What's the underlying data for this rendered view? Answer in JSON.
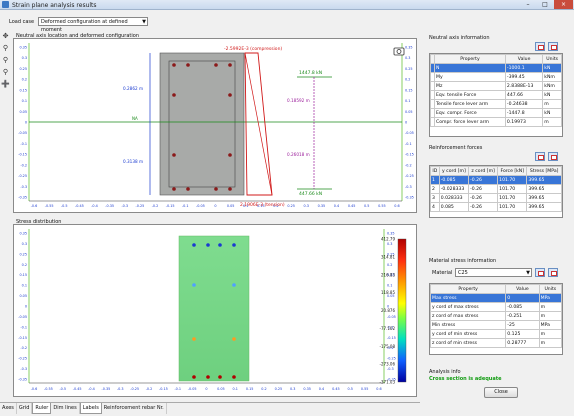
{
  "window": {
    "title": "Strain plane analysis results"
  },
  "toolbar": {
    "load_case_label": "Load case",
    "load_case_value": "Deformed configuration at defined moment"
  },
  "top_chart": {
    "title": "Neutral axis location and deformed configuration",
    "dim_top": "0.2862 m",
    "dim_bottom": "0.3138 m",
    "na_label": "NA",
    "compression_label": "-2.5992E-3 (compression)",
    "tension_label": "2.1906E-3 (tension)",
    "force_top": "1447.8 kN",
    "force_bottom": "447.66 kN",
    "lever_top": "0.18592 m",
    "lever_bottom": "0.26018 m",
    "y_ticks": [
      "0.35",
      "0.3",
      "0.25",
      "0.2",
      "0.15",
      "0.1",
      "0.05",
      "0",
      "-0.05",
      "-0.1",
      "-0.15",
      "-0.2",
      "-0.25",
      "-0.3",
      "-0.35"
    ],
    "x_ticks": [
      "-0.6",
      "-0.55",
      "-0.5",
      "-0.45",
      "-0.4",
      "-0.35",
      "-0.3",
      "-0.25",
      "-0.2",
      "-0.15",
      "-0.1",
      "-0.05",
      "0",
      "0.05",
      "0.1",
      "0.15",
      "0.2",
      "0.25",
      "0.3",
      "0.35",
      "0.4",
      "0.45",
      "0.5",
      "0.55",
      "0.6"
    ]
  },
  "bottom_chart": {
    "title": "Stress distribution",
    "legend_values": [
      "412.79",
      "314.81",
      "216.83",
      "118.85",
      "20.876",
      "-77.102",
      "-175.08",
      "-273.06",
      "-371.03"
    ],
    "y_ticks": [
      "0.35",
      "0.3",
      "0.25",
      "0.2",
      "0.15",
      "0.1",
      "0.05",
      "0",
      "-0.05",
      "-0.1",
      "-0.15",
      "-0.2",
      "-0.25",
      "-0.3",
      "-0.35"
    ],
    "x_ticks": [
      "-0.6",
      "-0.55",
      "-0.5",
      "-0.45",
      "-0.4",
      "-0.35",
      "-0.3",
      "-0.25",
      "-0.2",
      "-0.15",
      "-0.1",
      "-0.05",
      "0",
      "0.05",
      "0.1",
      "0.15",
      "0.2",
      "0.25",
      "0.3",
      "0.35",
      "0.4",
      "0.45",
      "0.5",
      "0.55",
      "0.6"
    ]
  },
  "tabs": [
    "Axes",
    "Grid",
    "Ruler",
    "Dim lines",
    "Labels",
    "Reinforcement rebar Nr."
  ],
  "neutral_axis": {
    "title": "Neutral axis information",
    "headers": [
      "Property",
      "Value",
      "Units"
    ],
    "rows": [
      [
        "N",
        "-1000.1",
        "kN"
      ],
      [
        "My",
        "-399.45",
        "kNm"
      ],
      [
        "Mz",
        "2.8388E-13",
        "kNm"
      ],
      [
        "Eqv. tensile Force",
        "447.66",
        "kN"
      ],
      [
        "Tensile force lever arm",
        "-0.24638",
        "m"
      ],
      [
        "Eqv. compr. Force",
        "-1447.8",
        "kN"
      ],
      [
        "Compr. force lever arm",
        "0.19973",
        "m"
      ]
    ]
  },
  "reinforcement": {
    "title": "Reinforcement forces",
    "headers": [
      "ID",
      "y cord [m]",
      "z cord [m]",
      "Force [kN]",
      "Stress [MPa]"
    ],
    "rows": [
      [
        "1",
        "-0.085",
        "-0.26",
        "101.70",
        "399.65"
      ],
      [
        "2",
        "-0.028333",
        "-0.26",
        "101.70",
        "399.65"
      ],
      [
        "3",
        "0.028333",
        "-0.26",
        "101.70",
        "399.65"
      ],
      [
        "4",
        "0.085",
        "-0.26",
        "101.70",
        "399.65"
      ]
    ]
  },
  "material": {
    "title": "Material stress information",
    "material_label": "Material",
    "material_value": "C25",
    "headers": [
      "Property",
      "Value",
      "Units"
    ],
    "rows": [
      [
        "Max stress",
        "0",
        "MPa"
      ],
      [
        "y cord of max stress",
        "-0.085",
        "m"
      ],
      [
        "z cord of max stress",
        "-0.251",
        "m"
      ],
      [
        "Min stress",
        "-25",
        "MPa"
      ],
      [
        "y cord of min stress",
        "0.125",
        "m"
      ],
      [
        "z cord of min stress",
        "0.28777",
        "m"
      ]
    ]
  },
  "analysis": {
    "title": "Analysis info",
    "message": "Cross section is adequate"
  },
  "close_label": "Close",
  "colors": {
    "accent": "#3875d7",
    "section_fill": "#a8aaa8",
    "rebar": "#8b1a1a",
    "force_pos": "#1a8a1a",
    "force_neg": "#1a3ad0",
    "strain": "#d01818"
  }
}
